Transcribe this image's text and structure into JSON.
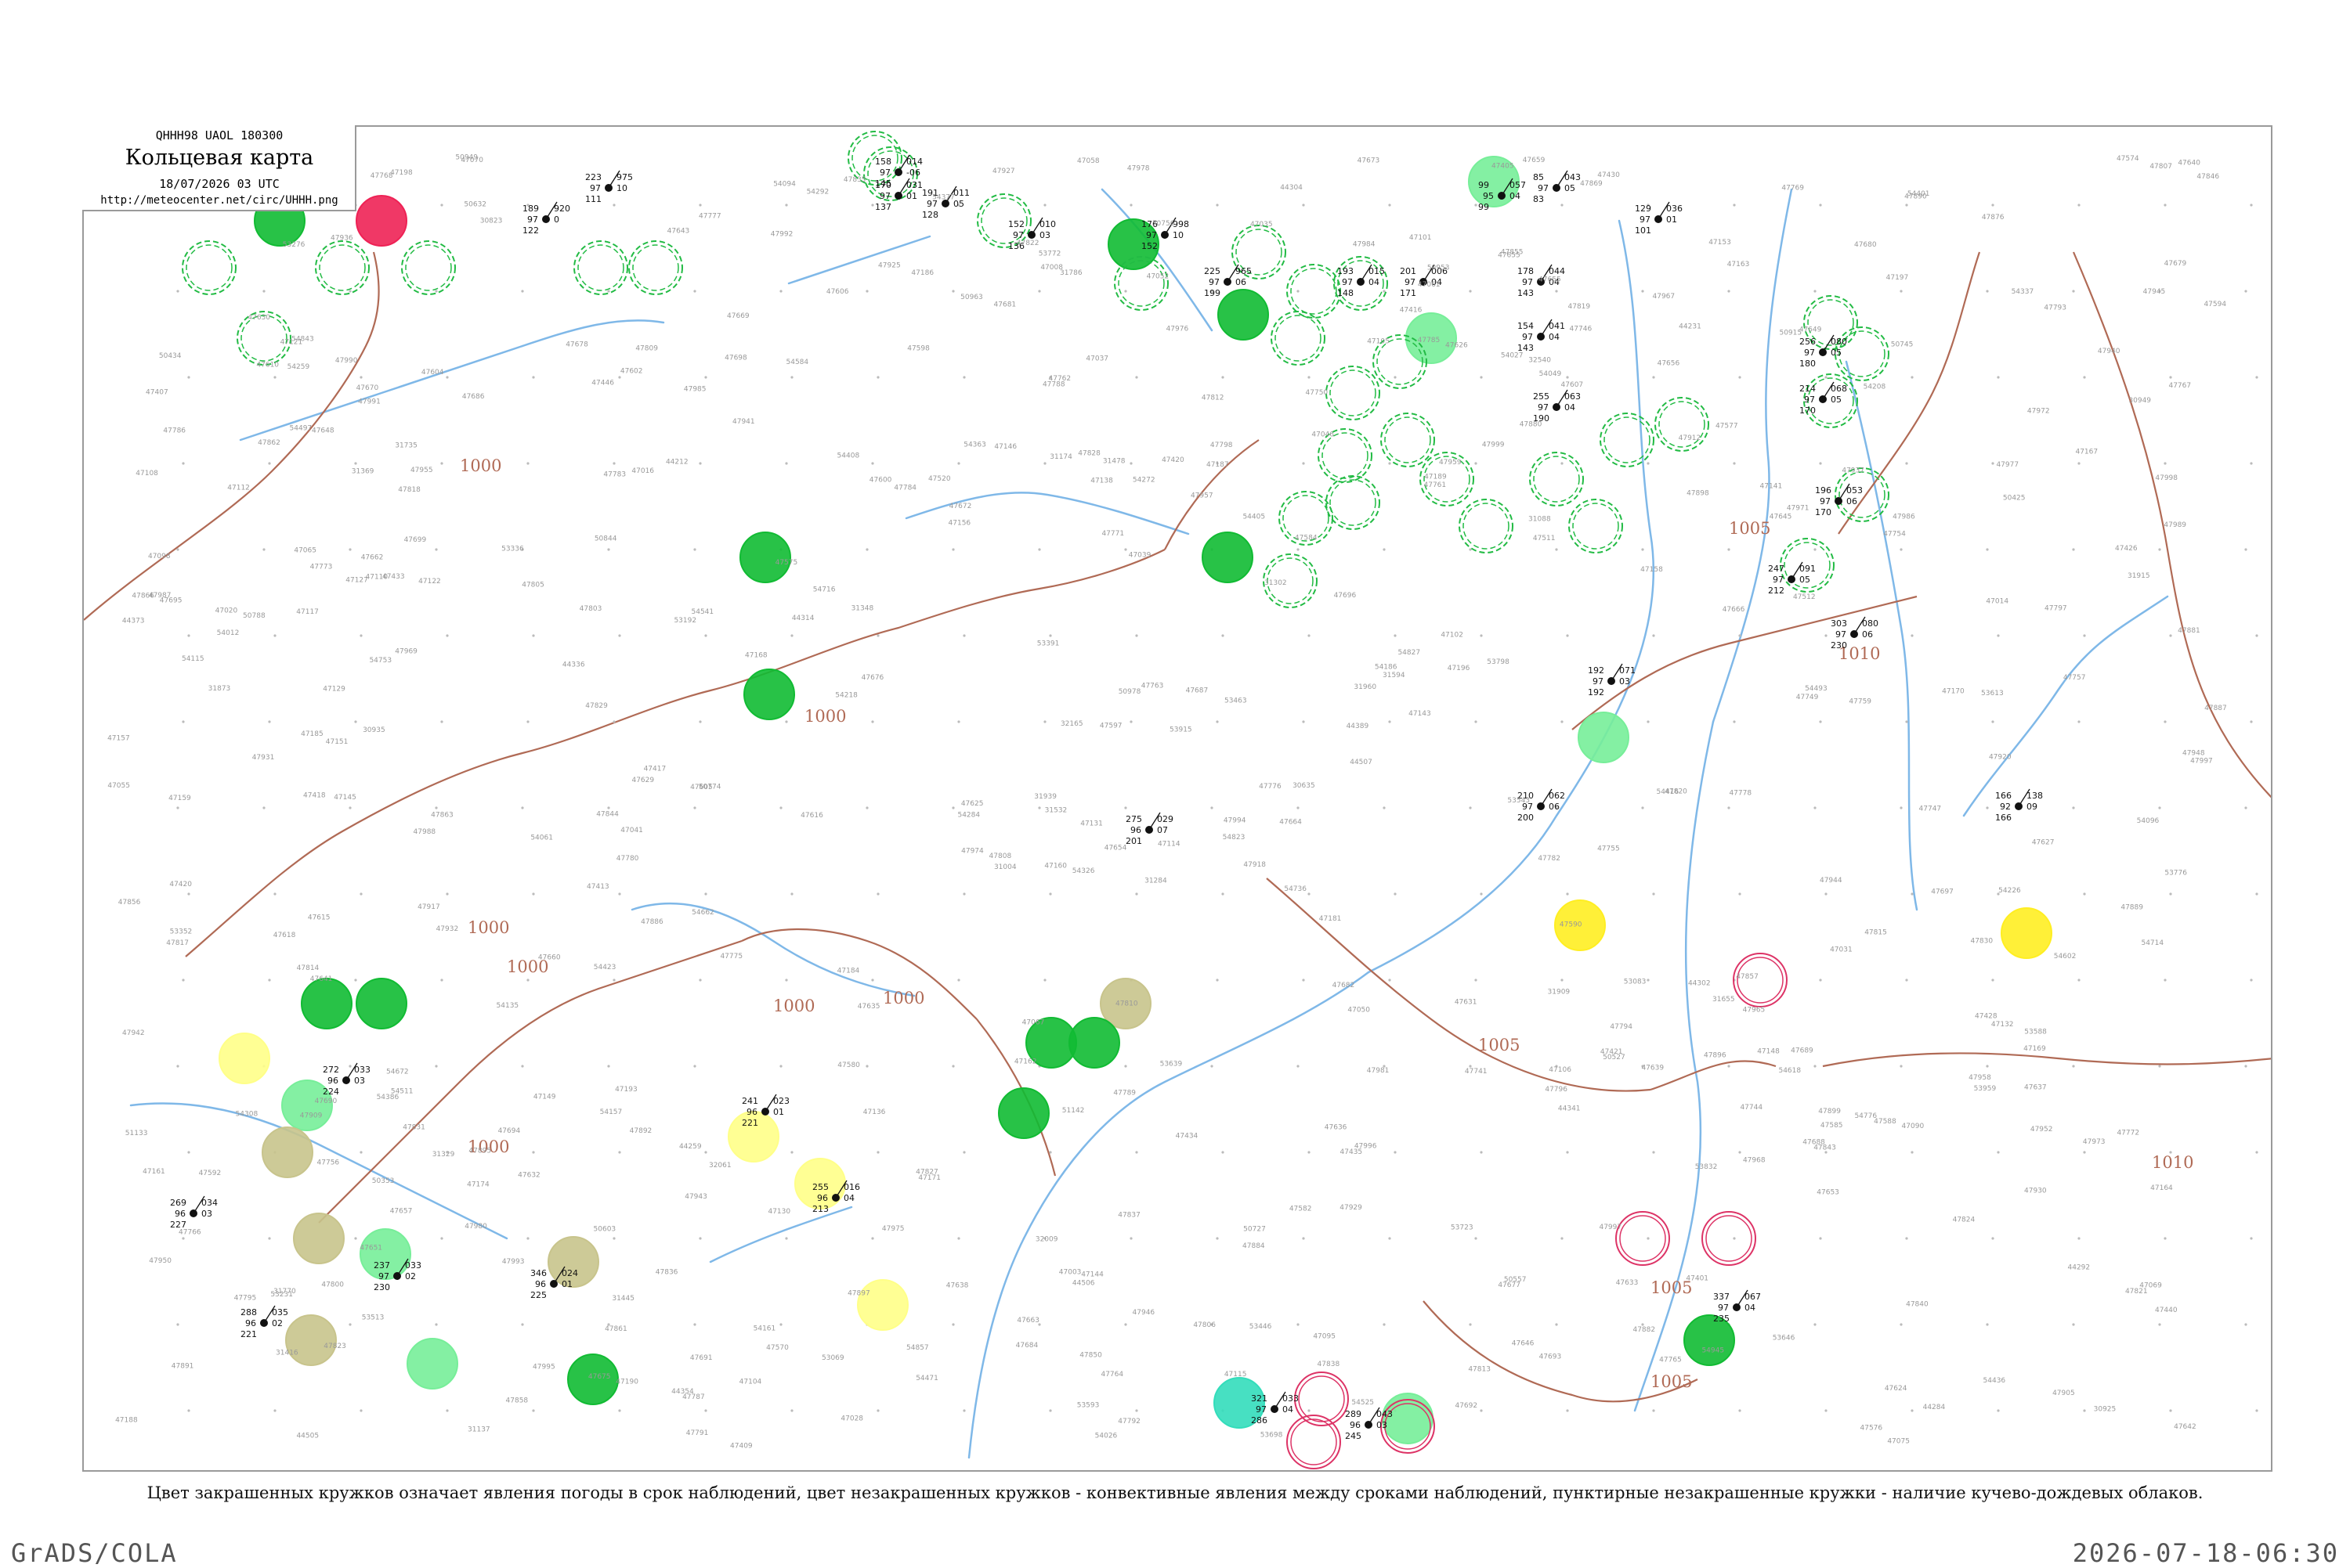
{
  "header": {
    "product_code": "QHHH98  UAOL  180300",
    "title": "Кольцевая карта",
    "datetime": "18/07/2026 03 UTC",
    "url": "http://meteocenter.net/circ/UHHH.png"
  },
  "caption": "Цвет закрашенных кружков означает явления погоды в срок наблюдений, цвет незакрашенных кружков - конвективные явления между сроками наблюдений, пунктирные незакрашенные кружки - наличие кучево-дождевых облаков.",
  "footer": {
    "left": "GrADS/COLA",
    "right": "2026-07-18-06:30"
  },
  "colors": {
    "river": "#7fb8e8",
    "isobar": "#b06a55",
    "green_rain": "#11bb33",
    "light_green": "#77ee99",
    "yellow": "#ffee22",
    "pale_yellow": "#ffff88",
    "olive_haze": "#c8c48c",
    "red_storm": "#ee2255",
    "teal": "#33ddbb",
    "cb_dashed": "#22bb44",
    "thunder_ring": "#dd3366"
  },
  "isobars": [
    {
      "value": "1000",
      "labels": [
        "1000",
        "1000",
        "1000",
        "1000",
        "1000",
        "1000",
        "1000"
      ]
    },
    {
      "value": "1005",
      "labels": [
        "1005",
        "1005",
        "1005",
        "1005"
      ]
    },
    {
      "value": "1010",
      "labels": [
        "1010",
        "1010"
      ]
    }
  ],
  "stations": [
    {
      "id": "s1",
      "pressure": "223",
      "tend": "975",
      "temp": "97",
      "extra": "10",
      "dew": "111"
    },
    {
      "id": "s2",
      "pressure": "189",
      "tend": "920",
      "temp": "97",
      "extra": "0",
      "dew": "122"
    },
    {
      "id": "s3",
      "pressure": "158",
      "tend": "014",
      "temp": "97",
      "extra": "-06",
      "dew": "145"
    },
    {
      "id": "s4",
      "pressure": "170",
      "tend": "031",
      "temp": "97",
      "extra": "01",
      "dew": "137"
    },
    {
      "id": "s5",
      "pressure": "191",
      "tend": "011",
      "temp": "97",
      "extra": "05",
      "dew": "128"
    },
    {
      "id": "s6",
      "pressure": "152",
      "tend": "010",
      "temp": "97",
      "extra": "03",
      "dew": "136"
    },
    {
      "id": "s7",
      "pressure": "176",
      "tend": "998",
      "temp": "97",
      "extra": "10",
      "dew": "152"
    },
    {
      "id": "s8",
      "pressure": "225",
      "tend": "965",
      "temp": "97",
      "extra": "06",
      "dew": "199"
    },
    {
      "id": "s9",
      "pressure": "193",
      "tend": "015",
      "temp": "97",
      "extra": "04",
      "dew": "148"
    },
    {
      "id": "s10",
      "pressure": "201",
      "tend": "006",
      "temp": "97",
      "extra": "04",
      "dew": "171"
    },
    {
      "id": "s11",
      "pressure": "99",
      "tend": "057",
      "temp": "95",
      "extra": "04",
      "dew": "99"
    },
    {
      "id": "s12",
      "pressure": "85",
      "tend": "043",
      "temp": "97",
      "extra": "05",
      "dew": "83"
    },
    {
      "id": "s13",
      "pressure": "129",
      "tend": "036",
      "temp": "97",
      "extra": "01",
      "dew": "101"
    },
    {
      "id": "s14",
      "pressure": "178",
      "tend": "044",
      "temp": "97",
      "extra": "04",
      "dew": "143"
    },
    {
      "id": "s15",
      "pressure": "154",
      "tend": "041",
      "temp": "97",
      "extra": "04",
      "dew": "143"
    },
    {
      "id": "s16",
      "pressure": "255",
      "tend": "063",
      "temp": "97",
      "extra": "04",
      "dew": "190"
    },
    {
      "id": "s17",
      "pressure": "256",
      "tend": "080",
      "temp": "97",
      "extra": "05",
      "dew": "180"
    },
    {
      "id": "s18",
      "pressure": "214",
      "tend": "068",
      "temp": "97",
      "extra": "05",
      "dew": "170"
    },
    {
      "id": "s19",
      "pressure": "196",
      "tend": "053",
      "temp": "97",
      "extra": "06",
      "dew": "170"
    },
    {
      "id": "s20",
      "pressure": "247",
      "tend": "091",
      "temp": "97",
      "extra": "05",
      "dew": "212"
    },
    {
      "id": "s21",
      "pressure": "303",
      "tend": "080",
      "temp": "97",
      "extra": "06",
      "dew": "230"
    },
    {
      "id": "s22",
      "pressure": "192",
      "tend": "071",
      "temp": "97",
      "extra": "03",
      "dew": "192"
    },
    {
      "id": "s23",
      "pressure": "166",
      "tend": "138",
      "temp": "92",
      "extra": "09",
      "dew": "166"
    },
    {
      "id": "s24",
      "pressure": "210",
      "tend": "062",
      "temp": "97",
      "extra": "06",
      "dew": "200"
    },
    {
      "id": "s25",
      "pressure": "275",
      "tend": "029",
      "temp": "96",
      "extra": "07",
      "dew": "201"
    },
    {
      "id": "s26",
      "pressure": "241",
      "tend": "023",
      "temp": "96",
      "extra": "01",
      "dew": "221"
    },
    {
      "id": "s27",
      "pressure": "255",
      "tend": "016",
      "temp": "96",
      "extra": "04",
      "dew": "213"
    },
    {
      "id": "s28",
      "pressure": "272",
      "tend": "033",
      "temp": "96",
      "extra": "03",
      "dew": "224"
    },
    {
      "id": "s29",
      "pressure": "269",
      "tend": "034",
      "temp": "96",
      "extra": "03",
      "dew": "227"
    },
    {
      "id": "s30",
      "pressure": "346",
      "tend": "024",
      "temp": "96",
      "extra": "01",
      "dew": "225"
    },
    {
      "id": "s31",
      "pressure": "288",
      "tend": "035",
      "temp": "96",
      "extra": "02",
      "dew": "221"
    },
    {
      "id": "s32",
      "pressure": "321",
      "tend": "033",
      "temp": "97",
      "extra": "04",
      "dew": "286"
    },
    {
      "id": "s33",
      "pressure": "289",
      "tend": "043",
      "temp": "96",
      "extra": "03",
      "dew": "245"
    },
    {
      "id": "s34",
      "pressure": "237",
      "tend": "033",
      "temp": "97",
      "extra": "02",
      "dew": "230"
    },
    {
      "id": "s35",
      "pressure": "337",
      "tend": "067",
      "temp": "97",
      "extra": "04",
      "dew": "235"
    }
  ],
  "station_codes": [
    "31284",
    "31369",
    "31532",
    "31770",
    "31960",
    "32061",
    "47655",
    "47420",
    "32540",
    "30635",
    "30823",
    "30925",
    "30935",
    "30949",
    "31004",
    "31088",
    "31137",
    "31174",
    "31302",
    "31329",
    "31348",
    "31416",
    "31445",
    "31478",
    "31594",
    "31655",
    "31735",
    "31786",
    "31873",
    "31909",
    "31915",
    "31939",
    "32009",
    "32165",
    "44212",
    "44231",
    "44259",
    "44284",
    "44292",
    "44302",
    "44304",
    "44314",
    "44336",
    "44341",
    "44354",
    "44373",
    "44389",
    "44505",
    "44506",
    "44507",
    "50353",
    "50425",
    "50434",
    "50527",
    "50557",
    "50603",
    "50632",
    "50658",
    "50727",
    "50745",
    "50756",
    "50774",
    "50788",
    "50844",
    "50915",
    "50949",
    "50953",
    "50963",
    "50978",
    "51133",
    "51142",
    "53069",
    "53083",
    "53192",
    "53231",
    "53276",
    "53336",
    "53352",
    "53391",
    "53446",
    "53463",
    "53513",
    "53543",
    "53588",
    "53593",
    "53613",
    "53639",
    "53646",
    "53698",
    "53723",
    "53772",
    "53776",
    "53798",
    "53832",
    "53915",
    "53959",
    "54012",
    "54026",
    "54027",
    "54049",
    "54061",
    "54094",
    "54096",
    "54115",
    "54135",
    "54157",
    "54161",
    "54186",
    "54208",
    "54218",
    "54226",
    "54259",
    "54272",
    "54284",
    "54292",
    "54308",
    "54326",
    "54337",
    "54363",
    "54377",
    "54386",
    "54401",
    "54405",
    "54408",
    "54416",
    "54423",
    "54436",
    "54471",
    "54493",
    "54497",
    "54511",
    "54525",
    "54541",
    "54584",
    "54602",
    "54618",
    "54662",
    "54672",
    "54714",
    "54716",
    "54736",
    "54753",
    "54776",
    "54823",
    "54827",
    "54843",
    "54857",
    "54945",
    "47003",
    "47008",
    "47014",
    "47016",
    "47020",
    "47028",
    "47031",
    "47035",
    "47037",
    "47039",
    "47041",
    "47046",
    "47050",
    "47052",
    "47055",
    "47058",
    "47061",
    "47065",
    "47067",
    "47069",
    "47070",
    "47075",
    "47090",
    "47095",
    "47098",
    "47101",
    "47102",
    "47104",
    "47105",
    "47106",
    "47108",
    "47110",
    "47112",
    "47114",
    "47115",
    "47117",
    "47121",
    "47122",
    "47127",
    "47129",
    "47130",
    "47131",
    "47132",
    "47136",
    "47138",
    "47141",
    "47143",
    "47144",
    "47145",
    "47146",
    "47148",
    "47149",
    "47151",
    "47153",
    "47156",
    "47157",
    "47158",
    "47159",
    "47160",
    "47161",
    "47162",
    "47163",
    "47164",
    "47167",
    "47168",
    "47169",
    "47170",
    "47171",
    "47174",
    "47181",
    "47184",
    "47185",
    "47186",
    "47187",
    "47188",
    "47189",
    "47190",
    "47193",
    "47196",
    "47197",
    "47198",
    "47401",
    "47405",
    "47407",
    "47409",
    "47412",
    "47413",
    "47416",
    "47417",
    "47418",
    "47420",
    "47421",
    "47426",
    "47428",
    "47430",
    "47433",
    "47434",
    "47435",
    "47440",
    "47446",
    "47511",
    "47512",
    "47520",
    "47570",
    "47574",
    "47575",
    "47576",
    "47577",
    "47580",
    "47582",
    "47584",
    "47585",
    "47588",
    "47590",
    "47592",
    "47594",
    "47597",
    "47598",
    "47600",
    "47602",
    "47604",
    "47605",
    "47606",
    "47607",
    "47610",
    "47615",
    "47616",
    "47618",
    "47624",
    "47625",
    "47626",
    "47627",
    "47629",
    "47630",
    "47631",
    "47632",
    "47633",
    "47635",
    "47636",
    "47637",
    "47638",
    "47639",
    "47640",
    "47641",
    "47642",
    "47643",
    "47645",
    "47646",
    "47648",
    "47649",
    "47651",
    "47653",
    "47654",
    "47655",
    "47656",
    "47657",
    "47659",
    "47660",
    "47662",
    "47663",
    "47664",
    "47666",
    "47669",
    "47670",
    "47672",
    "47673",
    "47675",
    "47676",
    "47677",
    "47678",
    "47679",
    "47680",
    "47681",
    "47682",
    "47684",
    "47686",
    "47687",
    "47688",
    "47689",
    "47690",
    "47691",
    "47692",
    "47693",
    "47694",
    "47695",
    "47696",
    "47697",
    "47698",
    "47699",
    "47741",
    "47744",
    "47746",
    "47747",
    "47749",
    "47750",
    "47754",
    "47755",
    "47756",
    "47757",
    "47759",
    "47761",
    "47762",
    "47763",
    "47764",
    "47765",
    "47766",
    "47767",
    "47768",
    "47769",
    "47771",
    "47772",
    "47773",
    "47775",
    "47776",
    "47777",
    "47778",
    "47780",
    "47782",
    "47783",
    "47784",
    "47785",
    "47786",
    "47787",
    "47788",
    "47789",
    "47791",
    "47792",
    "47793",
    "47794",
    "47795",
    "47796",
    "47797",
    "47798",
    "47800",
    "47803",
    "47805",
    "47806",
    "47807",
    "47808",
    "47809",
    "47810",
    "47812",
    "47813",
    "47814",
    "47815",
    "47817",
    "47818",
    "47819",
    "47820",
    "47821",
    "47822",
    "47823",
    "47824",
    "47827",
    "47828",
    "47829",
    "47830",
    "47831",
    "47835",
    "47836",
    "47837",
    "47838",
    "47840",
    "47843",
    "47844",
    "47846",
    "47850",
    "47855",
    "47856",
    "47857",
    "47858",
    "47861",
    "47862",
    "47863",
    "47866",
    "47869",
    "47876",
    "47880",
    "47881",
    "47882",
    "47884",
    "47886",
    "47887",
    "47889",
    "47890",
    "47891",
    "47892",
    "47893",
    "47895",
    "47896",
    "47897",
    "47898",
    "47899",
    "47905",
    "47909",
    "47912",
    "47917",
    "47918",
    "47920",
    "47925",
    "47927",
    "47929",
    "47930",
    "47931",
    "47932",
    "47936",
    "47937",
    "47940",
    "47941",
    "47942",
    "47943",
    "47944",
    "47945",
    "47946",
    "47948",
    "47950",
    "47952",
    "47955",
    "47957",
    "47958",
    "47959",
    "47965",
    "47967",
    "47968",
    "47969",
    "47971",
    "47972",
    "47973",
    "47974",
    "47975",
    "47976",
    "47977",
    "47978",
    "47980",
    "47981",
    "47984",
    "47985",
    "47986",
    "47987",
    "47988",
    "47989",
    "47990",
    "47991",
    "47992",
    "47993",
    "47994",
    "47995",
    "47996",
    "47997",
    "47998",
    "47999",
    "47997"
  ]
}
